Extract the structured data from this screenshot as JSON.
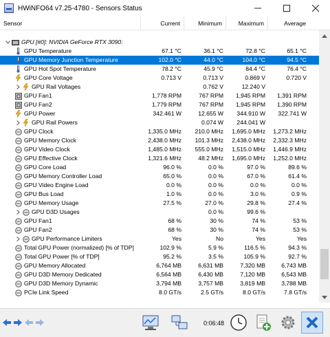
{
  "window": {
    "title": "HWiNFO64 v7.25-4780 - Sensors Status"
  },
  "columns": [
    "Sensor",
    "Current",
    "Minimum",
    "Maximum",
    "Average"
  ],
  "rows": [
    {
      "name": "GPU [#0]: NVIDIA GeForce RTX 3090:",
      "icon": "gpu-group-icon",
      "group": true,
      "expand": "collapse-arrow",
      "v": [
        "",
        "",
        "",
        ""
      ]
    },
    {
      "name": "GPU Temperature",
      "icon": "thermometer-icon",
      "v": [
        "67.1 °C",
        "36.1 °C",
        "72.8 °C",
        "65.1 °C"
      ]
    },
    {
      "name": "GPU Memory Junction Temperature",
      "icon": "thermometer-icon",
      "selected": true,
      "v": [
        "102.0 °C",
        "44.0 °C",
        "104.0 °C",
        "94.5 °C"
      ]
    },
    {
      "name": "GPU Hot Spot Temperature",
      "icon": "thermometer-icon",
      "v": [
        "78.2 °C",
        "45.9 °C",
        "84.4 °C",
        "76.4 °C"
      ]
    },
    {
      "name": "GPU Core Voltage",
      "icon": "lightning-icon",
      "v": [
        "0.713 V",
        "0.713 V",
        "0.869 V",
        "0.720 V"
      ]
    },
    {
      "name": "GPU Rail Voltages",
      "icon": "lightning-icon",
      "expand": "expand-arrow",
      "v": [
        "",
        "0.762 V",
        "12.240 V",
        ""
      ]
    },
    {
      "name": "GPU Fan1",
      "icon": "fan-icon",
      "v": [
        "1,778 RPM",
        "767 RPM",
        "1,945 RPM",
        "1,391 RPM"
      ]
    },
    {
      "name": "GPU Fan2",
      "icon": "fan-icon",
      "v": [
        "1,779 RPM",
        "767 RPM",
        "1,945 RPM",
        "1,390 RPM"
      ]
    },
    {
      "name": "GPU Power",
      "icon": "lightning-icon",
      "v": [
        "342.461 W",
        "12.655 W",
        "344.910 W",
        "322.741 W"
      ]
    },
    {
      "name": "GPU Rail Powers",
      "icon": "lightning-icon",
      "expand": "expand-arrow",
      "v": [
        "",
        "0.074 W",
        "244.041 W",
        ""
      ]
    },
    {
      "name": "GPU Clock",
      "icon": "clock-gauge-icon",
      "v": [
        "1,335.0 MHz",
        "210.0 MHz",
        "1,695.0 MHz",
        "1,273.2 MHz"
      ]
    },
    {
      "name": "GPU Memory Clock",
      "icon": "clock-gauge-icon",
      "v": [
        "2,438.0 MHz",
        "101.3 MHz",
        "2,438.0 MHz",
        "2,332.3 MHz"
      ]
    },
    {
      "name": "GPU Video Clock",
      "icon": "clock-gauge-icon",
      "v": [
        "1,485.0 MHz",
        "555.0 MHz",
        "1,515.0 MHz",
        "1,446.9 MHz"
      ]
    },
    {
      "name": "GPU Effective Clock",
      "icon": "clock-gauge-icon",
      "v": [
        "1,321.6 MHz",
        "48.2 MHz",
        "1,695.0 MHz",
        "1,252.0 MHz"
      ]
    },
    {
      "name": "GPU Core Load",
      "icon": "clock-gauge-icon",
      "v": [
        "96.0 %",
        "0.0 %",
        "97.0 %",
        "89.6 %"
      ]
    },
    {
      "name": "GPU Memory Controller Load",
      "icon": "clock-gauge-icon",
      "v": [
        "65.0 %",
        "0.0 %",
        "67.0 %",
        "61.4 %"
      ]
    },
    {
      "name": "GPU Video Engine Load",
      "icon": "clock-gauge-icon",
      "v": [
        "0.0 %",
        "0.0 %",
        "0.0 %",
        "0.0 %"
      ]
    },
    {
      "name": "GPU Bus Load",
      "icon": "clock-gauge-icon",
      "v": [
        "1.0 %",
        "0.0 %",
        "3.0 %",
        "0.9 %"
      ]
    },
    {
      "name": "GPU Memory Usage",
      "icon": "clock-gauge-icon",
      "v": [
        "27.5 %",
        "27.0 %",
        "29.8 %",
        "27.4 %"
      ]
    },
    {
      "name": "GPU D3D Usages",
      "icon": "clock-gauge-icon",
      "expand": "expand-arrow",
      "v": [
        "",
        "0.0 %",
        "99.6 %",
        ""
      ]
    },
    {
      "name": "GPU Fan1",
      "icon": "clock-gauge-icon",
      "v": [
        "68 %",
        "30 %",
        "74 %",
        "53 %"
      ]
    },
    {
      "name": "GPU Fan2",
      "icon": "clock-gauge-icon",
      "v": [
        "68 %",
        "30 %",
        "74 %",
        "53 %"
      ]
    },
    {
      "name": "GPU Performance Limiters",
      "icon": "clock-gauge-icon",
      "expand": "expand-arrow",
      "v": [
        "Yes",
        "No",
        "Yes",
        "Yes"
      ]
    },
    {
      "name": "Total GPU Power (normalized) [% of TDP]",
      "icon": "clock-gauge-icon",
      "v": [
        "102.9 %",
        "5.9 %",
        "116.5 %",
        "94.3 %"
      ]
    },
    {
      "name": "Total GPU Power [% of TDP]",
      "icon": "clock-gauge-icon",
      "v": [
        "95.2 %",
        "3.5 %",
        "105.9 %",
        "92.7 %"
      ]
    },
    {
      "name": "GPU Memory Allocated",
      "icon": "clock-gauge-icon",
      "v": [
        "6,764 MB",
        "6,631 MB",
        "7,320 MB",
        "6,743 MB"
      ]
    },
    {
      "name": "GPU D3D Memory Dedicated",
      "icon": "clock-gauge-icon",
      "v": [
        "6,564 MB",
        "6,430 MB",
        "7,120 MB",
        "6,543 MB"
      ]
    },
    {
      "name": "GPU D3D Memory Dynamic",
      "icon": "clock-gauge-icon",
      "v": [
        "3,794 MB",
        "3,757 MB",
        "3,819 MB",
        "3,788 MB"
      ]
    },
    {
      "name": "PCIe Link Speed",
      "icon": "clock-gauge-icon",
      "v": [
        "8.0 GT/s",
        "2.5 GT/s",
        "8.0 GT/s",
        "7.8 GT/s"
      ]
    }
  ],
  "toolbar": {
    "elapsed": "0:06:48",
    "buttons": [
      "nav-arrows-icon",
      "nav-arrows-dim-icon",
      "monitor-icon",
      "network-icon",
      "clock-icon",
      "add-sheet-icon",
      "gear-icon",
      "close-x-icon"
    ]
  },
  "colors": {
    "selection": "#0078d7",
    "toolbar_bg": "#f0f0f0",
    "scroll_thumb": "#cdcdcd"
  }
}
